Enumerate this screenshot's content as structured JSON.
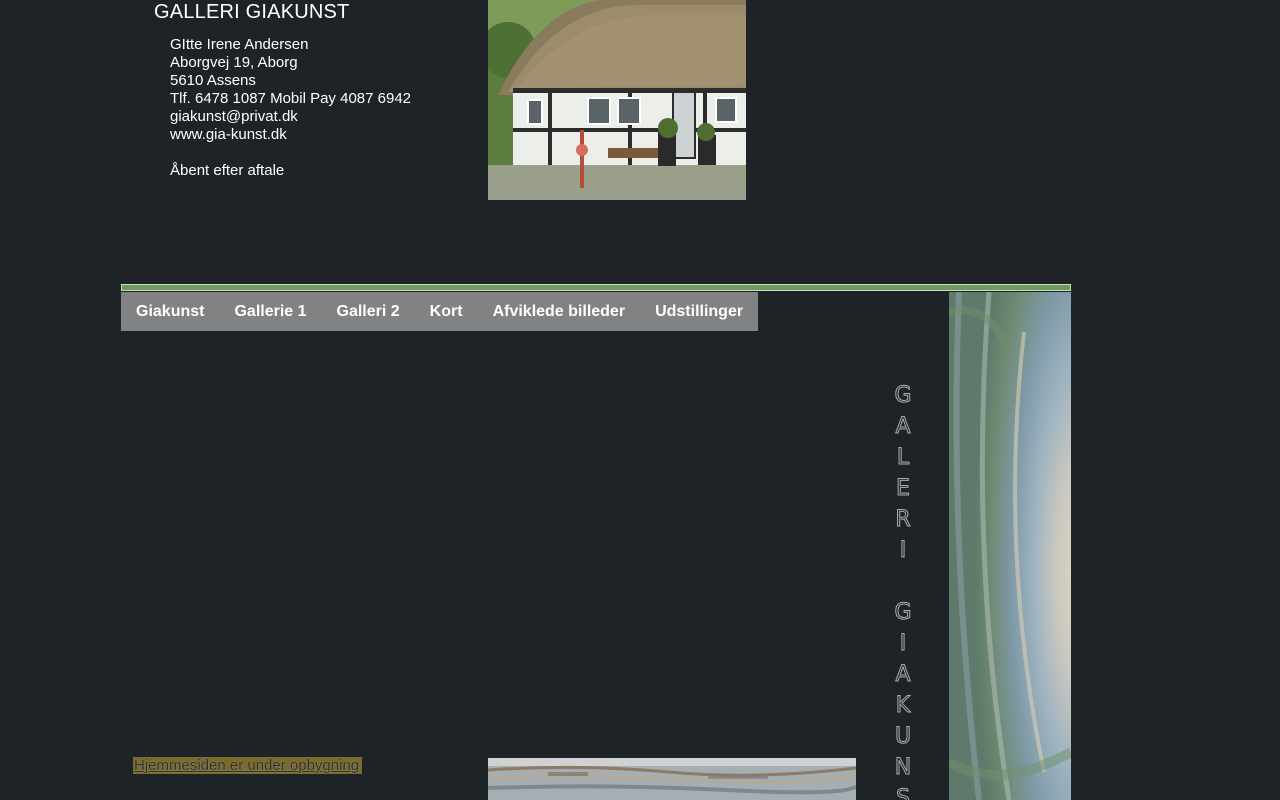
{
  "header": {
    "site_title": "GALLERI GIAKUNST"
  },
  "contact": {
    "name": "GItte Irene Andersen",
    "address": "Aborgvej 19, Aborg",
    "city": "5610 Assens",
    "phone": "Tlf. 6478 1087 Mobil Pay 4087 6942",
    "email": "giakunst@privat.dk",
    "website": "www.gia-kunst.dk",
    "hours": "Åbent efter aftale"
  },
  "nav": {
    "items": [
      {
        "label": "Giakunst"
      },
      {
        "label": "Gallerie 1"
      },
      {
        "label": "Galleri 2"
      },
      {
        "label": "Kort"
      },
      {
        "label": "Afviklede billeder"
      },
      {
        "label": "Udstillinger"
      }
    ]
  },
  "vertical_title": {
    "letters": [
      "G",
      "A",
      "L",
      "E",
      "R",
      "I",
      "",
      "G",
      "I",
      "A",
      "K",
      "U",
      "N",
      "S"
    ]
  },
  "notice": {
    "text": "Hjemmesiden er under opbygning"
  },
  "colors": {
    "background": "#1d2326",
    "nav_background": "#818283",
    "divider": "#6f9a5f",
    "notice_background": "#7a6a2c"
  }
}
